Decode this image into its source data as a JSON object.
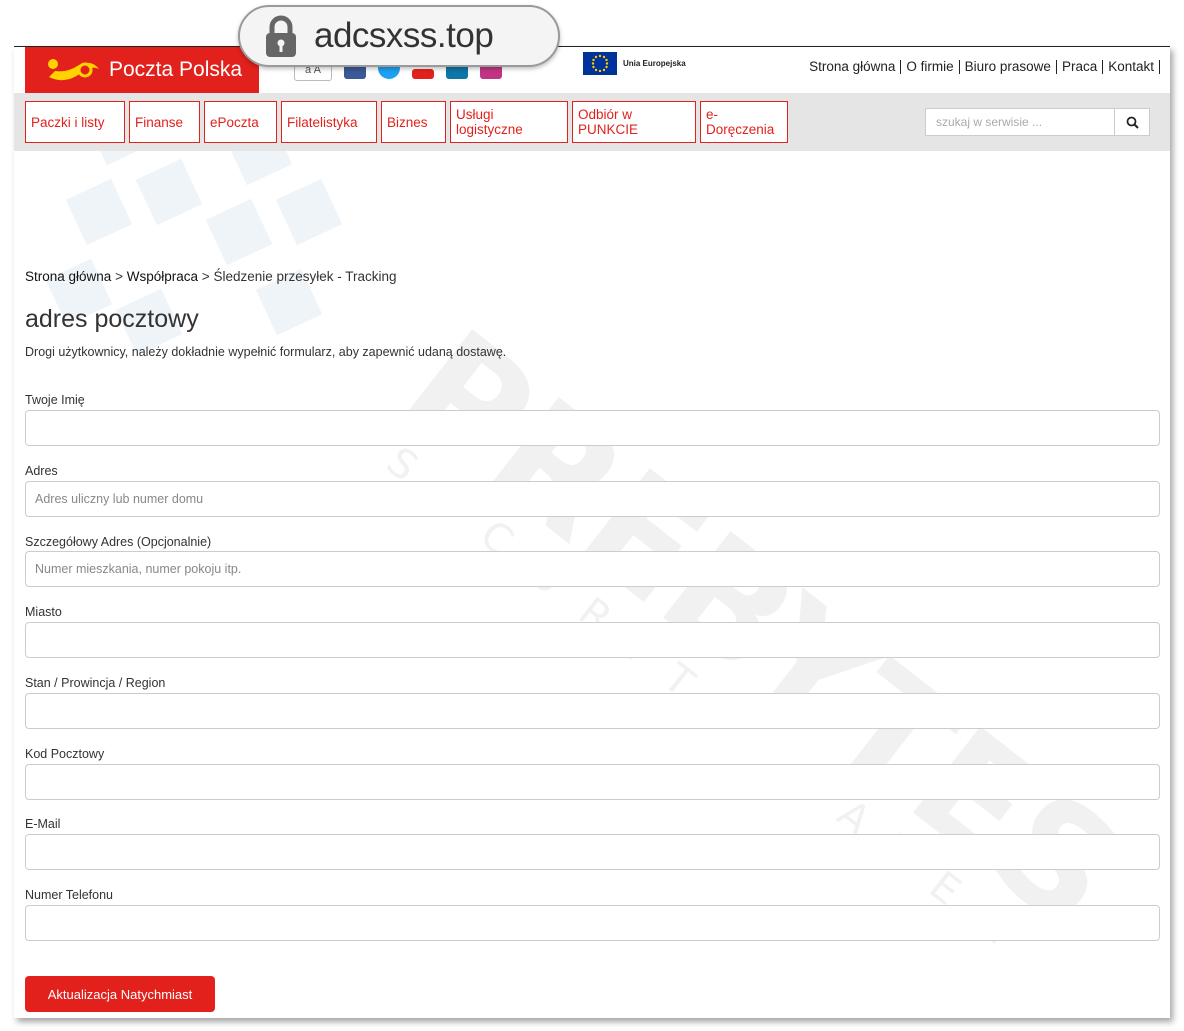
{
  "url_bar": {
    "domain": "adcsxss.top",
    "lock_icon": "lock-icon"
  },
  "header": {
    "logo_text": "Poczta Polska",
    "az_label": "a A",
    "social_icons": [
      "facebook-icon",
      "twitter-icon",
      "blog-icon",
      "linkedin-icon",
      "instagram-icon"
    ],
    "eu_label": "Unia Europejska",
    "top_links": [
      "Strona główna",
      "O firmie",
      "Biuro prasowe",
      "Praca",
      "Kontakt"
    ]
  },
  "nav": {
    "items": [
      "Paczki i listy",
      "Finanse",
      "ePoczta",
      "Filatelistyka",
      "Biznes",
      "Usługi logistyczne",
      "Odbiór w PUNKCIE",
      "e-Doręczenia"
    ],
    "search_placeholder": "szukaj w serwisie ...",
    "search_icon": "search-icon"
  },
  "breadcrumb": {
    "home": "Strona główna",
    "sep": ">",
    "section": "Współpraca",
    "current": "Śledzenie przesyłek - Tracking"
  },
  "page": {
    "title": "adres pocztowy",
    "intro": "Drogi użytkownicy, należy dokładnie wypełnić formularz, aby zapewnić udaną dostawę."
  },
  "form": {
    "fields": [
      {
        "label": "Twoje Imię",
        "placeholder": ""
      },
      {
        "label": "Adres",
        "placeholder": "Adres uliczny lub numer domu"
      },
      {
        "label": "Szczegółowy Adres (Opcjonalnie)",
        "placeholder": "Numer mieszkania, numer pokoju itp."
      },
      {
        "label": "Miasto",
        "placeholder": ""
      },
      {
        "label": "Stan / Prowincja / Region",
        "placeholder": ""
      },
      {
        "label": "Kod Pocztowy",
        "placeholder": ""
      },
      {
        "label": "E-Mail",
        "placeholder": ""
      },
      {
        "label": "Numer Telefonu",
        "placeholder": ""
      }
    ],
    "submit_label": "Aktualizacja Natychmiast"
  },
  "watermark": {
    "brand": "PREBYTES",
    "tagline": "SECURITY LAYER"
  },
  "colors": {
    "brand_red": "#e2211c",
    "nav_bg": "#e5e5e5"
  }
}
